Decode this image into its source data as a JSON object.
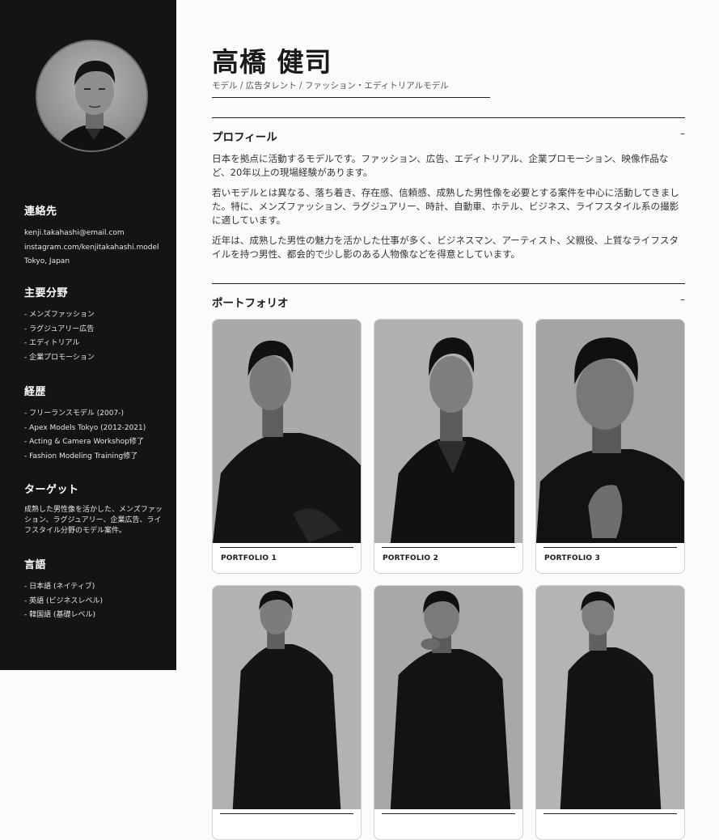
{
  "sidebar": {
    "contact": {
      "heading": "連絡先",
      "items": [
        "kenji.takahashi@email.com",
        "instagram.com/kenjitakahashi.model",
        "Tokyo, Japan"
      ]
    },
    "fields": {
      "heading": "主要分野",
      "items": [
        "- メンズファッション",
        "- ラグジュアリー広告",
        "- エディトリアル",
        "- 企業プロモーション"
      ]
    },
    "career": {
      "heading": "経歴",
      "items": [
        "- フリーランスモデル (2007-)",
        "- Apex Models Tokyo (2012-2021)",
        "- Acting & Camera Workshop修了",
        "- Fashion Modeling Training修了"
      ]
    },
    "target": {
      "heading": "ターゲット",
      "text": "成熟した男性像を活かした、メンズファッション、ラグジュアリー、企業広告、ライフスタイル分野のモデル案件。"
    },
    "languages": {
      "heading": "言語",
      "items": [
        "- 日本語 (ネイティブ)",
        "- 英語 (ビジネスレベル)",
        "- 韓国語 (基礎レベル)"
      ]
    }
  },
  "header": {
    "name": "高橋 健司",
    "subtitle": "モデル / 広告タレント / ファッション・エディトリアルモデル"
  },
  "profile": {
    "heading": "プロフィール",
    "toggle": "–",
    "paragraphs": [
      "日本を拠点に活動するモデルです。ファッション、広告、エディトリアル、企業プロモーション、映像作品など、20年以上の現場経験があります。",
      "若いモデルとは異なる、落ち着き、存在感、信頼感、成熟した男性像を必要とする案件を中心に活動してきました。特に、メンズファッション、ラグジュアリー、時計、自動車、ホテル、ビジネス、ライフスタイル系の撮影に適しています。",
      "近年は、成熟した男性の魅力を活かした仕事が多く、ビジネスマン、アーティスト、父親役、上質なライフスタイルを持つ男性、都会的で少し影のある人物像などを得意としています。"
    ]
  },
  "portfolio": {
    "heading": "ポートフォリオ",
    "toggle": "–",
    "items": [
      {
        "caption": "PORTFOLIO 1"
      },
      {
        "caption": "PORTFOLIO 2"
      },
      {
        "caption": "PORTFOLIO 3"
      },
      {
        "caption": ""
      },
      {
        "caption": ""
      },
      {
        "caption": ""
      }
    ]
  }
}
